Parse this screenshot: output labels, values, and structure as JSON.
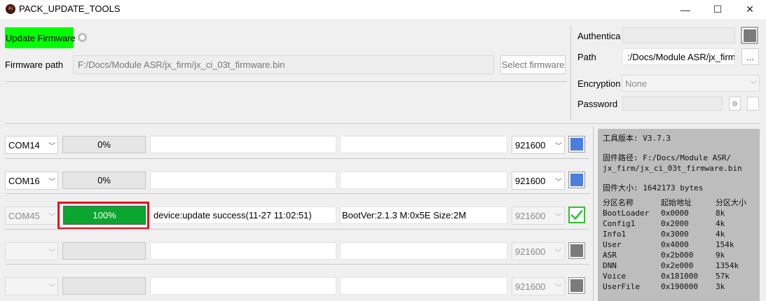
{
  "window": {
    "title": "PACK_UPDATE_TOOLS",
    "icon_text": "Ai",
    "minimize_glyph": "—",
    "maximize_glyph": "☐",
    "close_glyph": "✕"
  },
  "top": {
    "update_firmware_label": "Update Firmware",
    "firmware_path_label": "Firmware path",
    "firmware_path_value": "F:/Docs/Module ASR/jx_firm/jx_ci_03t_firmware.bin",
    "select_firmware_label": "Select firmware"
  },
  "right_form": {
    "auth_label": "Authentica",
    "path_label": "Path",
    "path_value": ":/Docs/Module ASR/jx_firm",
    "browse_label": "...",
    "encryption_label": "Encryption",
    "encryption_value": "None",
    "password_label": "Password",
    "eye_glyph": "⊙"
  },
  "ports": [
    {
      "port": "COM14",
      "progress_text": "0%",
      "progress": 0,
      "status_text": "",
      "info_text": "",
      "baud": "921600",
      "state": "blue",
      "enabled": true
    },
    {
      "port": "COM16",
      "progress_text": "0%",
      "progress": 0,
      "status_text": "",
      "info_text": "",
      "baud": "921600",
      "state": "blue",
      "enabled": true
    },
    {
      "port": "COM45",
      "progress_text": "100%",
      "progress": 1.0,
      "status_text": "device:update success(11-27 11:02:51)",
      "info_text": "BootVer:2.1.3 M:0x5E Size:2M",
      "baud": "921600",
      "state": "ok",
      "enabled": false
    },
    {
      "port": "",
      "progress_text": "",
      "progress": 0,
      "status_text": "",
      "info_text": "",
      "baud": "921600",
      "state": "gray",
      "enabled": false
    },
    {
      "port": "",
      "progress_text": "",
      "progress": 0,
      "status_text": "",
      "info_text": "",
      "baud": "921600",
      "state": "gray",
      "enabled": false
    }
  ],
  "log": {
    "version_line": "工具版本: V3.7.3",
    "path_line1": "固件路径: F:/Docs/Module ASR/",
    "path_line2": "jx_firm/jx_ci_03t_firmware.bin",
    "size_line": "固件大小: 1642173 bytes",
    "table_headers": [
      "分区名称",
      "起始地址",
      "分区大小"
    ],
    "partitions": [
      [
        "BootLoader",
        "0x0000",
        "8k"
      ],
      [
        "Config1",
        "0x2000",
        "4k"
      ],
      [
        "Info1",
        "0x3000",
        "4k"
      ],
      [
        "User",
        "0x4000",
        "154k"
      ],
      [
        "ASR",
        "0x2b000",
        "9k"
      ],
      [
        "DNN",
        "0x2e000",
        "1354k"
      ],
      [
        "Voice",
        "0x181000",
        "57k"
      ],
      [
        "UserFile",
        "0x190000",
        "3k"
      ]
    ]
  },
  "colors": {
    "update_firmware_bg": "#00ff00",
    "progress_done": "#0aa62f",
    "highlight_border": "#e3121d",
    "status_blue": "#4a7fe0",
    "status_ok": "#2fc02f",
    "log_bg": "#bdbdbd"
  }
}
